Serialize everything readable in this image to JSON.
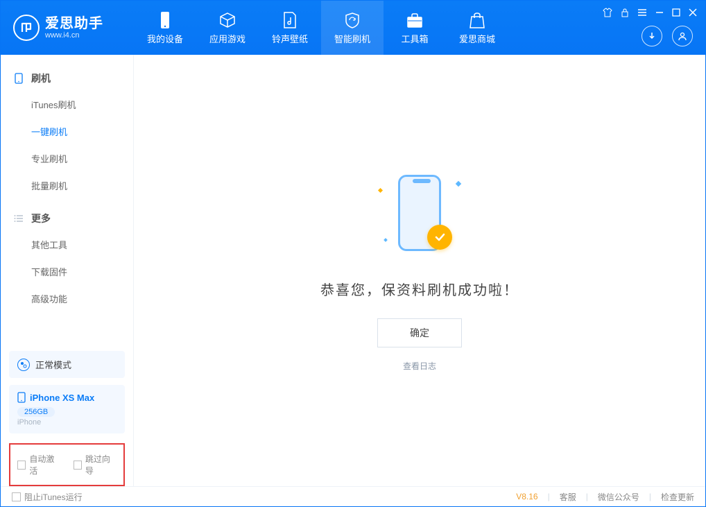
{
  "app": {
    "title": "爱思助手",
    "subtitle": "www.i4.cn"
  },
  "nav": {
    "tabs": [
      {
        "label": "我的设备"
      },
      {
        "label": "应用游戏"
      },
      {
        "label": "铃声壁纸"
      },
      {
        "label": "智能刷机"
      },
      {
        "label": "工具箱"
      },
      {
        "label": "爱思商城"
      }
    ]
  },
  "sidebar": {
    "sections": [
      {
        "title": "刷机",
        "items": [
          {
            "label": "iTunes刷机"
          },
          {
            "label": "一键刷机",
            "active": true
          },
          {
            "label": "专业刷机"
          },
          {
            "label": "批量刷机"
          }
        ]
      },
      {
        "title": "更多",
        "items": [
          {
            "label": "其他工具"
          },
          {
            "label": "下载固件"
          },
          {
            "label": "高级功能"
          }
        ]
      }
    ],
    "mode": "正常模式",
    "device": {
      "name": "iPhone XS Max",
      "storage": "256GB",
      "type": "iPhone"
    },
    "checks": {
      "auto_activate": "自动激活",
      "skip_guide": "跳过向导"
    }
  },
  "main": {
    "success_text": "恭喜您，保资料刷机成功啦！",
    "confirm": "确定",
    "view_log": "查看日志"
  },
  "footer": {
    "left": "阻止iTunes运行",
    "version": "V8.16",
    "links": [
      "客服",
      "微信公众号",
      "检查更新"
    ]
  }
}
